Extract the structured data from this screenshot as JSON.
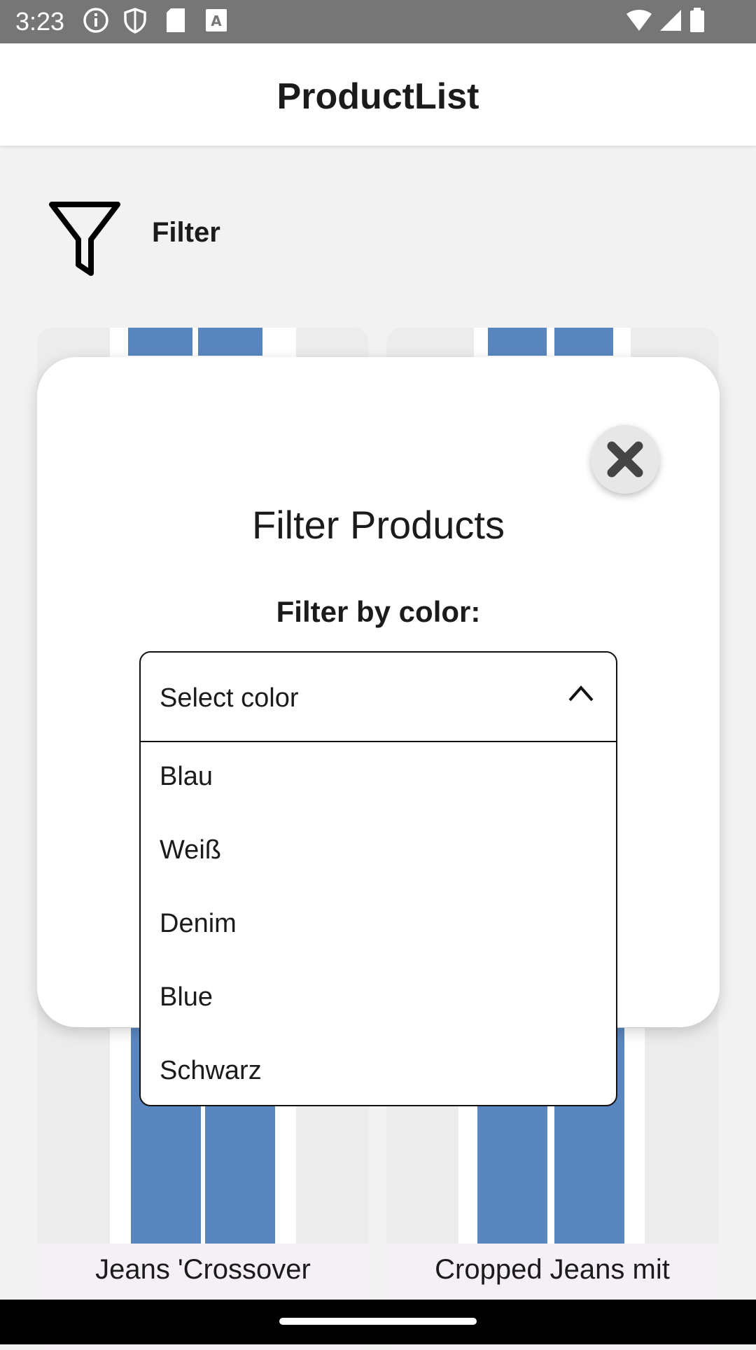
{
  "status_bar": {
    "time": "3:23",
    "left_icons": [
      "info-icon",
      "shield-icon",
      "sd-card-icon",
      "keyboard-a-icon"
    ],
    "right_icons": [
      "wifi-icon",
      "signal-icon",
      "battery-icon"
    ]
  },
  "app_bar": {
    "title": "ProductList"
  },
  "filter": {
    "icon": "filter-funnel-icon",
    "label": "Filter"
  },
  "products": [
    {
      "name": "Jeans 'Crossover"
    },
    {
      "name": "Cropped Jeans mit"
    }
  ],
  "modal": {
    "title": "Filter Products",
    "subtitle": "Filter by color:",
    "close_icon": "close-icon",
    "dropdown": {
      "placeholder": "Select color",
      "expanded": true,
      "options": [
        "Blau",
        "Weiß",
        "Denim",
        "Blue",
        "Schwarz"
      ]
    }
  },
  "colors": {
    "status_bar": "#767676",
    "nav_bar": "#000000",
    "background": "#f2f2f2"
  }
}
